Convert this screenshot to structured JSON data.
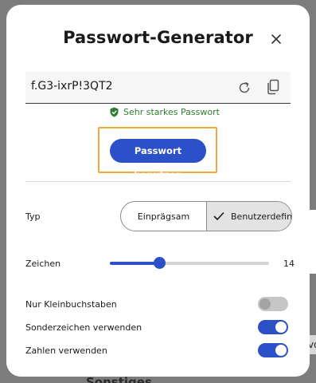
{
  "dialog": {
    "title": "Passwort-Generator",
    "close_icon": "close-icon"
  },
  "password": {
    "value": "f.G3-ixrP!3QT2",
    "refresh_icon": "refresh-icon",
    "copy_icon": "copy-icon",
    "strength_icon": "shield-check-icon",
    "strength_label": "Sehr starkes Passwort",
    "strength_color": "#2e7d32"
  },
  "use_button_label": "Passwort benutzen",
  "type": {
    "label": "Typ",
    "options": [
      "Einprägsam",
      "Benutzerdefiniert"
    ],
    "selected": "Benutzerdefiniert",
    "selected_visible_text": "Benutzerdefini",
    "check_icon": "checkmark-icon"
  },
  "length": {
    "label": "Zeichen",
    "value": "14",
    "slider_fraction": 0.31
  },
  "options": [
    {
      "label": "Nur Kleinbuchstaben",
      "enabled": false
    },
    {
      "label": "Sonderzeichen verwenden",
      "enabled": true
    },
    {
      "label": "Zahlen verwenden",
      "enabled": true
    }
  ],
  "colors": {
    "accent": "#2c50c8",
    "focus": "#f0a93b"
  },
  "background": {
    "bottom_text": "Sonstiges",
    "right_text": "vo"
  }
}
